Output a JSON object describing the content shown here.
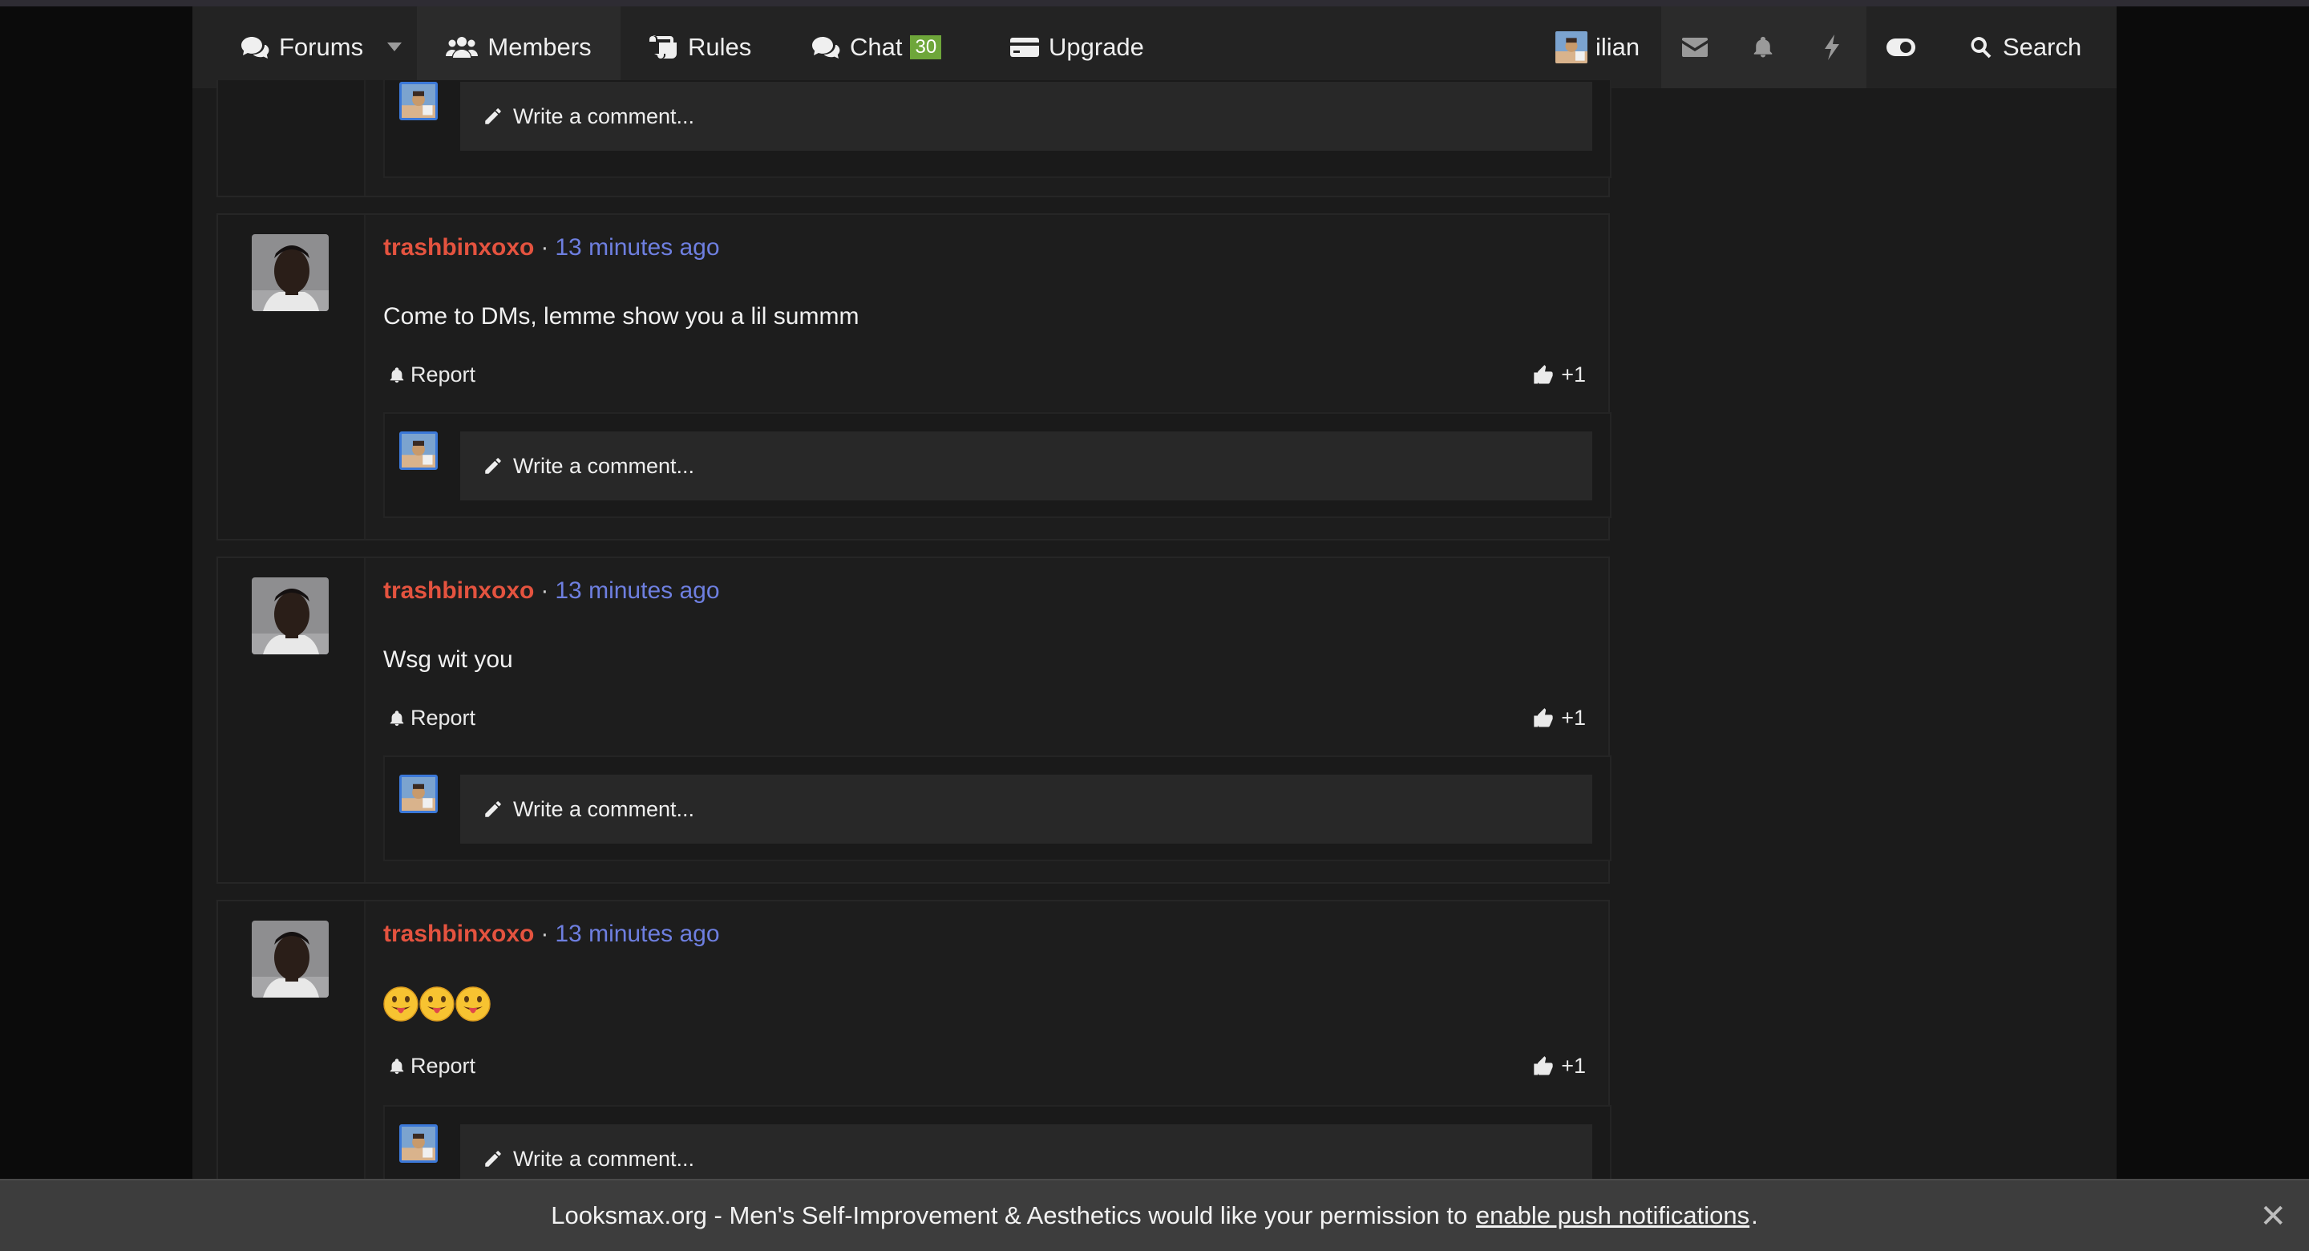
{
  "nav": {
    "forums": "Forums",
    "members": "Members",
    "rules": "Rules",
    "chat": "Chat",
    "chat_badge": "30",
    "upgrade": "Upgrade",
    "username": "ilian",
    "search": "Search"
  },
  "top_partial_comment": {
    "write_placeholder": "Write a comment..."
  },
  "posts": [
    {
      "username": "trashbinxoxo",
      "separator": "·",
      "time": "13 minutes ago",
      "message": "Come to DMs, lemme show you a lil summm",
      "report": "Report",
      "likes": "+1",
      "write_placeholder": "Write a comment..."
    },
    {
      "username": "trashbinxoxo",
      "separator": "·",
      "time": "13 minutes ago",
      "message": "Wsg wit you",
      "report": "Report",
      "likes": "+1",
      "write_placeholder": "Write a comment..."
    },
    {
      "username": "trashbinxoxo",
      "separator": "·",
      "time": "13 minutes ago",
      "message_emojis": [
        "tongue-out-emoji",
        "tongue-out-emoji",
        "tongue-out-emoji"
      ],
      "report": "Report",
      "likes": "+1",
      "write_placeholder": "Write a comment..."
    }
  ],
  "banner": {
    "text_before": "Looksmax.org - Men's Self-Improvement & Aesthetics would like your permission to",
    "link": "enable push notifications",
    "text_after": ".",
    "close": "✕"
  },
  "colors": {
    "username": "#e4533f",
    "timestamp": "#6e7fe0",
    "badge": "#6ea63a",
    "background": "#1b1b1b",
    "nav": "#232323"
  }
}
